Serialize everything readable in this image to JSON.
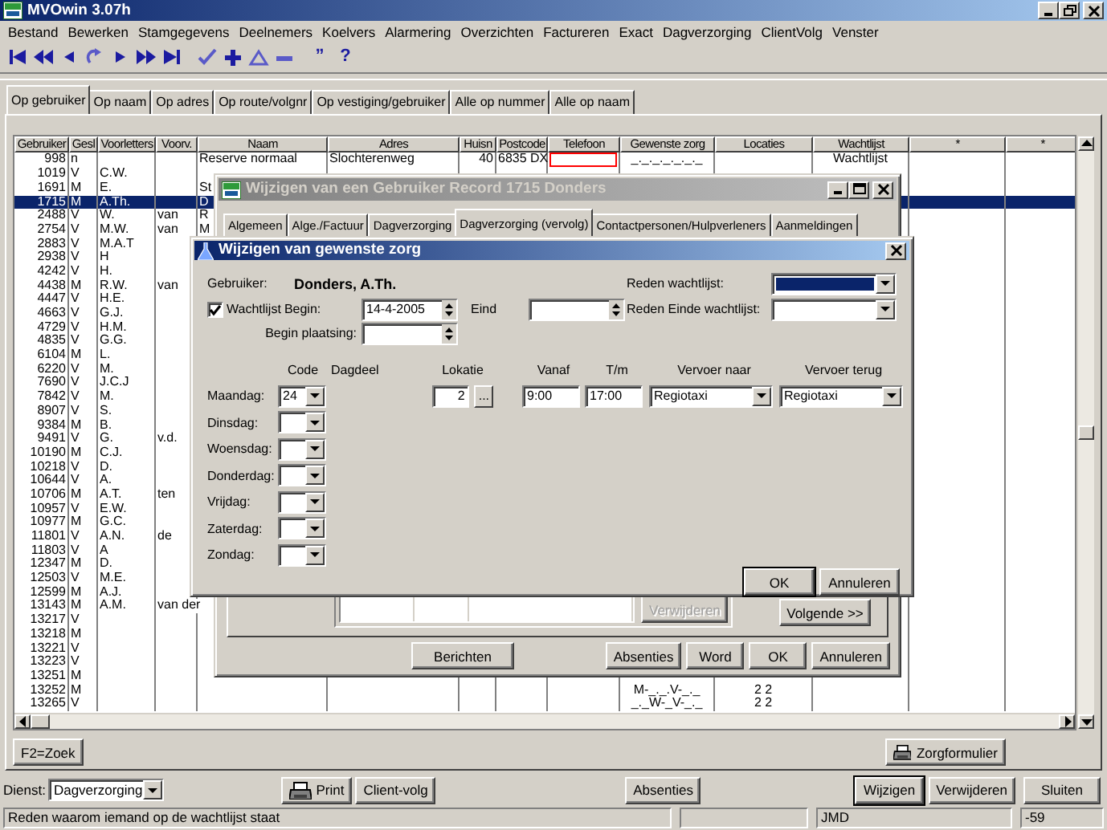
{
  "window": {
    "title": "MVOwin 3.07h"
  },
  "menu": [
    "Bestand",
    "Bewerken",
    "Stamgegevens",
    "Deelnemers",
    "Koelvers",
    "Alarmering",
    "Overzichten",
    "Factureren",
    "Exact",
    "Dagverzorging",
    "ClientVolg",
    "Venster"
  ],
  "toolbar": [
    {
      "kind": "first"
    },
    {
      "kind": "rewind"
    },
    {
      "kind": "prev"
    },
    {
      "kind": "redo"
    },
    {
      "kind": "next"
    },
    {
      "kind": "forward"
    },
    {
      "kind": "last"
    },
    {
      "kind": "check",
      "group_start": true
    },
    {
      "kind": "plus"
    },
    {
      "kind": "triangle"
    },
    {
      "kind": "minus"
    },
    {
      "kind": "glyph",
      "text": "”",
      "group_start": true
    },
    {
      "kind": "glyph",
      "text": "?"
    }
  ],
  "tabs": [
    {
      "label": "Op gebruiker",
      "selected": true
    },
    {
      "label": "Op naam",
      "selected": false
    },
    {
      "label": "Op adres",
      "selected": false
    },
    {
      "label": "Op route/volgnr",
      "selected": false
    },
    {
      "label": "Op vestiging/gebruiker",
      "selected": false
    },
    {
      "label": "Alle op nummer",
      "selected": false
    },
    {
      "label": "Alle op naam",
      "selected": false
    }
  ],
  "grid": {
    "columns": [
      "Gebruiker",
      "Gesl",
      "Voorletters",
      "Voorv.",
      "Naam",
      "Adres",
      "Huisn",
      "Postcode",
      "Telefoon",
      "Gewenste zorg",
      "Locaties",
      "Wachtlijst",
      "*",
      "*"
    ],
    "rows": [
      {
        "gebruiker": "998",
        "gesl": "n",
        "naam": "Reserve normaal",
        "adres": "Slochterenweg",
        "huisnr": "40",
        "postcode": "6835 DX",
        "telefoon_marked": true,
        "gewenste_zorg": "_._._._._._._",
        "wachtlijst": "Wachtlijst",
        "selected": false
      },
      {
        "gebruiker": "1019",
        "gesl": "V",
        "voorletters": "C.W.",
        "selected": false
      },
      {
        "gebruiker": "1691",
        "gesl": "M",
        "voorletters": "E.",
        "naam": "St",
        "selected": false
      },
      {
        "gebruiker": "1715",
        "gesl": "M",
        "voorletters": "A.Th.",
        "naam": "D",
        "selected": true
      },
      {
        "gebruiker": "2488",
        "gesl": "V",
        "voorletters": "W.",
        "voorv": "van",
        "naam": "R",
        "selected": false
      },
      {
        "gebruiker": "2754",
        "gesl": "V",
        "voorletters": "M.W.",
        "voorv": "van",
        "naam": "M",
        "selected": false
      },
      {
        "gebruiker": "2883",
        "gesl": "V",
        "voorletters": "M.A.T",
        "selected": false
      },
      {
        "gebruiker": "2938",
        "gesl": "V",
        "voorletters": "H",
        "selected": false
      },
      {
        "gebruiker": "4242",
        "gesl": "V",
        "voorletters": "H.",
        "selected": false
      },
      {
        "gebruiker": "4438",
        "gesl": "M",
        "voorletters": "R.W.",
        "voorv": "van",
        "selected": false
      },
      {
        "gebruiker": "4447",
        "gesl": "V",
        "voorletters": "H.E.",
        "selected": false
      },
      {
        "gebruiker": "4663",
        "gesl": "V",
        "voorletters": "G.J.",
        "selected": false
      },
      {
        "gebruiker": "4729",
        "gesl": "V",
        "voorletters": "H.M.",
        "selected": false
      },
      {
        "gebruiker": "4835",
        "gesl": "V",
        "voorletters": "G.G.",
        "selected": false
      },
      {
        "gebruiker": "6104",
        "gesl": "M",
        "voorletters": "L.",
        "selected": false
      },
      {
        "gebruiker": "6220",
        "gesl": "V",
        "voorletters": "M.",
        "selected": false
      },
      {
        "gebruiker": "7690",
        "gesl": "V",
        "voorletters": "J.C.J",
        "selected": false
      },
      {
        "gebruiker": "7842",
        "gesl": "V",
        "voorletters": "M.",
        "selected": false
      },
      {
        "gebruiker": "8907",
        "gesl": "V",
        "voorletters": "S.",
        "selected": false
      },
      {
        "gebruiker": "9384",
        "gesl": "M",
        "voorletters": "B.",
        "selected": false
      },
      {
        "gebruiker": "9491",
        "gesl": "V",
        "voorletters": "G.",
        "voorv": "v.d.",
        "selected": false
      },
      {
        "gebruiker": "10190",
        "gesl": "M",
        "voorletters": "C.J.",
        "selected": false
      },
      {
        "gebruiker": "10218",
        "gesl": "V",
        "voorletters": "D.",
        "selected": false
      },
      {
        "gebruiker": "10644",
        "gesl": "V",
        "voorletters": "A.",
        "selected": false
      },
      {
        "gebruiker": "10706",
        "gesl": "M",
        "voorletters": "A.T.",
        "voorv": "ten",
        "selected": false
      },
      {
        "gebruiker": "10957",
        "gesl": "V",
        "voorletters": "E.W.",
        "selected": false
      },
      {
        "gebruiker": "10977",
        "gesl": "M",
        "voorletters": "G.C.",
        "selected": false
      },
      {
        "gebruiker": "11801",
        "gesl": "V",
        "voorletters": "A.N.",
        "voorv": "de",
        "selected": false
      },
      {
        "gebruiker": "11803",
        "gesl": "V",
        "voorletters": "A",
        "selected": false
      },
      {
        "gebruiker": "12347",
        "gesl": "M",
        "voorletters": "D.",
        "selected": false
      },
      {
        "gebruiker": "12503",
        "gesl": "V",
        "voorletters": "M.E.",
        "selected": false
      },
      {
        "gebruiker": "12599",
        "gesl": "M",
        "voorletters": "A.J.",
        "selected": false
      },
      {
        "gebruiker": "13143",
        "gesl": "M",
        "voorletters": "A.M.",
        "voorv": "van der",
        "selected": false
      },
      {
        "gebruiker": "13217",
        "gesl": "V",
        "selected": false
      },
      {
        "gebruiker": "13218",
        "gesl": "M",
        "selected": false
      },
      {
        "gebruiker": "13221",
        "gesl": "V",
        "selected": false
      },
      {
        "gebruiker": "13223",
        "gesl": "V",
        "selected": false
      },
      {
        "gebruiker": "13251",
        "gesl": "M",
        "selected": false
      },
      {
        "gebruiker": "13252",
        "gesl": "M",
        "gewenste_zorg": "M-_._.V-_._",
        "locaties": "2 2",
        "selected": false
      },
      {
        "gebruiker": "13265",
        "gesl": "V",
        "gewenste_zorg": "_._W-_V-_._",
        "locaties": "2 2",
        "selected": false
      }
    ]
  },
  "search_button": "F2=Zoek",
  "form_button": "Zorgformulier",
  "dienst": {
    "label": "Dienst:",
    "value": "Dagverzorging"
  },
  "actions_left": [
    {
      "label": "Print",
      "kind": "print"
    },
    {
      "label": "Client-volg",
      "kind": "plain"
    }
  ],
  "actions_mid": [
    {
      "label": "Absenties"
    }
  ],
  "actions_right": [
    {
      "label": "Wijzigen",
      "default": true
    },
    {
      "label": "Verwijderen",
      "default": false
    },
    {
      "label": "Sluiten",
      "default": false
    }
  ],
  "status_bar": {
    "message": "Reden waarom iemand op de wachtlijst staat",
    "user": "JMD",
    "code": "-59"
  },
  "record_dialog": {
    "title": "Wijzigen van een Gebruiker Record 1715 Donders",
    "tabs": [
      {
        "label": "Algemeen",
        "selected": false
      },
      {
        "label": "Alge./Factuur",
        "selected": false
      },
      {
        "label": "Dagverzorging",
        "selected": false
      },
      {
        "label": "Dagverzorging (vervolg)",
        "selected": true
      },
      {
        "label": "Contactpersonen/Hulpverleners",
        "selected": false
      },
      {
        "label": "Aanmeldingen",
        "selected": false
      }
    ],
    "remove_button": {
      "label": "Verwijderen",
      "disabled": true
    },
    "next_button": "Volgende >>",
    "messages_button": "Berichten",
    "buttons": [
      "Absenties",
      "Word",
      "OK",
      "Annuleren"
    ]
  },
  "zorg_dialog": {
    "title": "Wijzigen van gewenste zorg",
    "user_label": "Gebruiker:",
    "user_name": "Donders, A.Th.",
    "waitlist": {
      "label": "Wachtlijst",
      "checked": true
    },
    "begin_label": "Begin:",
    "begin_value": "14-4-2005",
    "eind_label": "Eind",
    "plaatsing_label": "Begin plaatsing:",
    "reden": {
      "label": "Reden wachtlijst:",
      "focused": true
    },
    "reden_einde": {
      "label": "Reden Einde wachtlijst:",
      "focused": false
    },
    "columns": [
      "Code",
      "Dagdeel",
      "Lokatie",
      "Vanaf",
      "T/m",
      "Vervoer naar",
      "Vervoer terug"
    ],
    "days": [
      {
        "label": "Maandag:",
        "code": "24",
        "lokatie": "2",
        "lokatie_button": "...",
        "vanaf": "9:00",
        "tm": "17:00",
        "vervoer_naar": "Regiotaxi",
        "vervoer_terug": "Regiotaxi"
      },
      {
        "label": "Dinsdag:"
      },
      {
        "label": "Woensdag:"
      },
      {
        "label": "Donderdag:"
      },
      {
        "label": "Vrijdag:"
      },
      {
        "label": "Zaterdag:"
      },
      {
        "label": "Zondag:"
      }
    ],
    "buttons": [
      {
        "label": "OK",
        "default": true
      },
      {
        "label": "Annuleren",
        "default": false
      }
    ]
  }
}
